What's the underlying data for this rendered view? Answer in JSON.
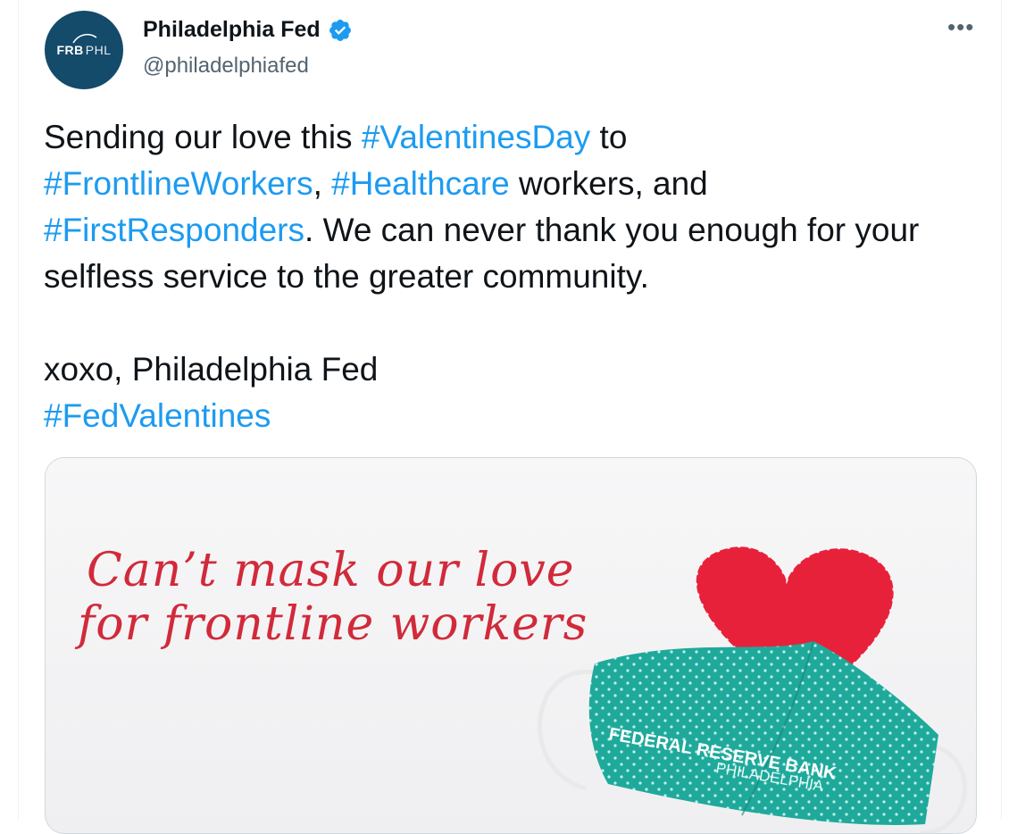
{
  "tweet": {
    "display_name": "Philadelphia Fed",
    "handle": "@philadelphiafed",
    "more_label": "•••",
    "avatar_text_left": "FRB",
    "avatar_text_right": "PHL",
    "text": {
      "p1_a": "Sending our love this ",
      "tag1": "#ValentinesDay",
      "p1_b": " to",
      "tag2": "#FrontlineWorkers",
      "p1_c": ", ",
      "tag3": "#Healthcare",
      "p1_d": " workers, and",
      "tag4": "#FirstResponders",
      "p1_e": ". We can never thank you enough for your selfless service to the greater community.",
      "signoff": "xoxo, Philadelphia Fed",
      "tag5": "#FedValentines"
    }
  },
  "media": {
    "headline_line1": "Can’t mask our love",
    "headline_line2": "for frontline workers",
    "mask_text_line1": "FEDERAL RESERVE BANK",
    "mask_text_line2": "PHILADELPHIA"
  },
  "colors": {
    "link": "#1d9bf0",
    "verified": "#1d9bf0",
    "avatar_bg": "#144a6a",
    "headline": "#d12a3a",
    "heart": "#e8213a",
    "mask": "#1fa99b"
  },
  "icons": [
    "verified-badge-icon",
    "more-options-icon",
    "frb-phl-logo"
  ]
}
